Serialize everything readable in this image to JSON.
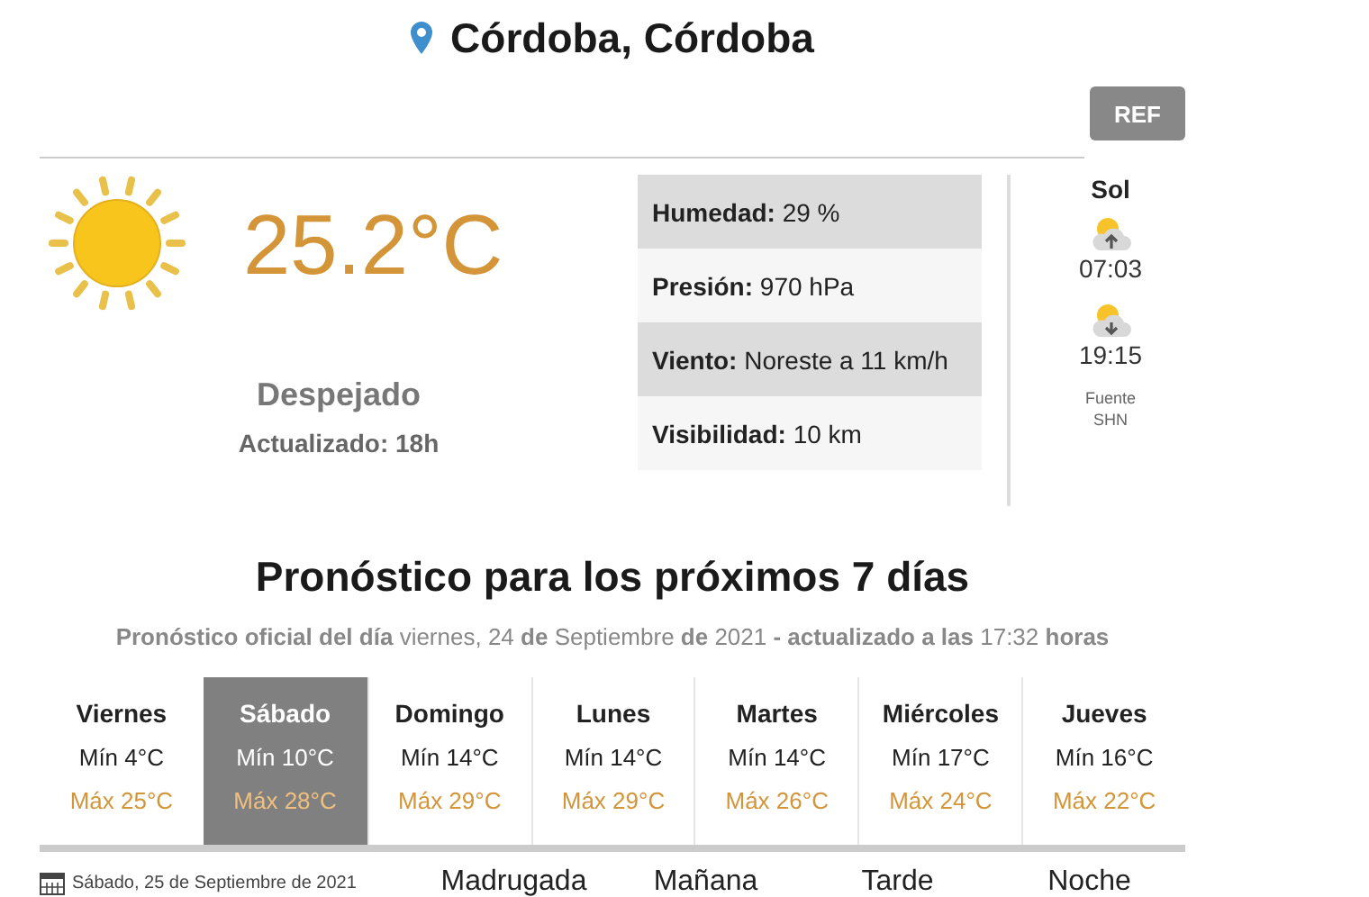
{
  "location": {
    "title": "Córdoba, Córdoba"
  },
  "ref_button": "REF",
  "current": {
    "temperature": "25.2°C",
    "condition": "Despejado",
    "updated": "Actualizado: 18h"
  },
  "stats": [
    {
      "label": "Humedad:",
      "value": "29 %",
      "shaded": true
    },
    {
      "label": "Presión:",
      "value": "970 hPa",
      "shaded": false
    },
    {
      "label": "Viento:",
      "value": "Noreste a 11 km/h",
      "shaded": true
    },
    {
      "label": "Visibilidad:",
      "value": "10 km",
      "shaded": false
    }
  ],
  "sun": {
    "title": "Sol",
    "events": [
      {
        "kind": "sunrise",
        "time": "07:03"
      },
      {
        "kind": "sunset",
        "time": "19:15"
      }
    ],
    "source": [
      "Fuente",
      "SHN"
    ]
  },
  "forecast": {
    "title": "Pronóstico para los próximos 7 días",
    "subtitle": "**Pronóstico oficial del día** viernes, 24 **de** Septiembre **de** 2021 **- actualizado a las** 17:32 **horas**",
    "days": [
      {
        "day": "Viernes",
        "min": "Mín 4°C",
        "max": "Máx 25°C",
        "selected": false
      },
      {
        "day": "Sábado",
        "min": "Mín 10°C",
        "max": "Máx 28°C",
        "selected": true
      },
      {
        "day": "Domingo",
        "min": "Mín 14°C",
        "max": "Máx 29°C",
        "selected": false
      },
      {
        "day": "Lunes",
        "min": "Mín 14°C",
        "max": "Máx 29°C",
        "selected": false
      },
      {
        "day": "Martes",
        "min": "Mín 14°C",
        "max": "Máx 26°C",
        "selected": false
      },
      {
        "day": "Miércoles",
        "min": "Mín 17°C",
        "max": "Máx 24°C",
        "selected": false
      },
      {
        "day": "Jueves",
        "min": "Mín 16°C",
        "max": "Máx 22°C",
        "selected": false
      }
    ]
  },
  "detail": {
    "date": "Sábado, 25 de Septiembre de 2021",
    "periods": [
      "Madrugada",
      "Mañana",
      "Tarde",
      "Noche"
    ]
  }
}
